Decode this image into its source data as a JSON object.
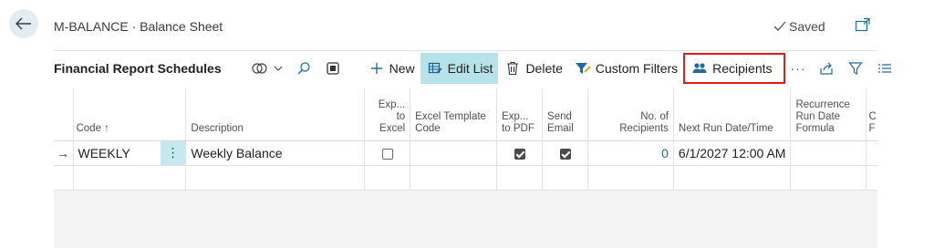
{
  "header": {
    "title": "M-BALANCE · Balance Sheet",
    "saved_label": "Saved"
  },
  "actionbar": {
    "title": "Financial Report Schedules",
    "new_label": "New",
    "edit_list_label": "Edit List",
    "delete_label": "Delete",
    "custom_filters_label": "Custom Filters",
    "recipients_label": "Recipients",
    "more_label": "···"
  },
  "table": {
    "columns": [
      {
        "key": "arrow",
        "label": ""
      },
      {
        "key": "code",
        "label": "Code ↑"
      },
      {
        "key": "menu",
        "label": ""
      },
      {
        "key": "description",
        "label": "Description"
      },
      {
        "key": "export_excel",
        "label": "Exp... to Excel"
      },
      {
        "key": "excel_template",
        "label": "Excel Template Code"
      },
      {
        "key": "export_pdf",
        "label": "Exp... to PDF"
      },
      {
        "key": "send_email",
        "label": "Send Email"
      },
      {
        "key": "no_recipients",
        "label": "No. of Recipients"
      },
      {
        "key": "next_run",
        "label": "Next Run Date/Time"
      },
      {
        "key": "recurrence",
        "label": "Recurrence Run Date Formula"
      },
      {
        "key": "cut",
        "label": "C F"
      }
    ],
    "rows": [
      {
        "arrow": "→",
        "code": "WEEKLY",
        "menu": "⋮",
        "description": "Weekly Balance",
        "export_excel": false,
        "excel_template": "",
        "export_pdf": true,
        "send_email": true,
        "no_recipients": "0",
        "next_run": "6/1/2027 12:00 AM",
        "recurrence": ""
      }
    ]
  },
  "colors": {
    "accent_selected": "#b6e3ea",
    "highlight_border": "#e01b1b",
    "link": "#1f6c9c"
  }
}
